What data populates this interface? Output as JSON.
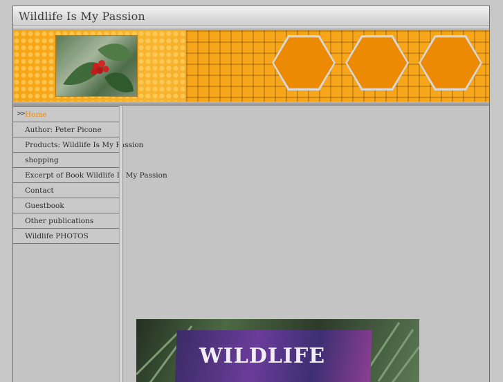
{
  "header": {
    "title": "Wildlife Is My Passion"
  },
  "nav": {
    "items": [
      {
        "label": "Home",
        "active": true
      },
      {
        "label": "Author: Peter Picone"
      },
      {
        "label": "Products: Wildlife Is My Passion"
      },
      {
        "label": "shopping"
      },
      {
        "label": "Excerpt of Book Wildlife Is My Passion"
      },
      {
        "label": "Contact"
      },
      {
        "label": "Guestbook"
      },
      {
        "label": "Other publications"
      },
      {
        "label": "Wildlife PHOTOS"
      }
    ]
  },
  "main": {
    "book_image_text": "WILDLIFE"
  },
  "colors": {
    "accent": "#f2880a",
    "banner": "#f7a51a",
    "hex": "#ec8a04"
  }
}
